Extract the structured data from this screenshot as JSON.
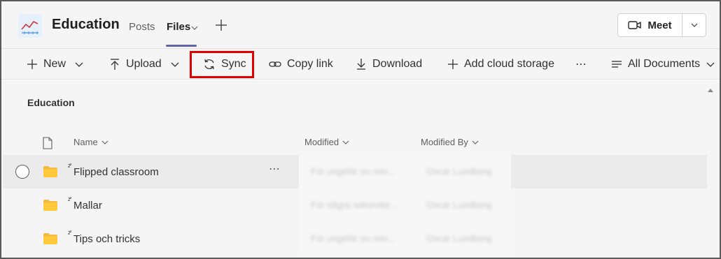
{
  "header": {
    "team_name": "Education",
    "tabs": [
      {
        "label": "Posts",
        "active": false
      },
      {
        "label": "Files",
        "active": true
      }
    ],
    "meet_label": "Meet",
    "accent_color": "#6264a7"
  },
  "toolbar": {
    "new_label": "New",
    "upload_label": "Upload",
    "sync_label": "Sync",
    "copy_link_label": "Copy link",
    "download_label": "Download",
    "add_cloud_storage_label": "Add cloud storage",
    "more_label": "⋯",
    "view_label": "All Documents",
    "highlight_color": "#e00000"
  },
  "library": {
    "title": "Education",
    "columns": {
      "name": "Name",
      "modified": "Modified",
      "modified_by": "Modified By"
    },
    "rows": [
      {
        "name": "Flipped classroom",
        "modified": "För ungefär en min...",
        "modified_by": "Oscar Lundberg",
        "hovered": true
      },
      {
        "name": "Mallar",
        "modified": "För några sekunder...",
        "modified_by": "Oscar Lundberg",
        "hovered": false
      },
      {
        "name": "Tips och tricks",
        "modified": "För ungefär en min...",
        "modified_by": "Oscar Lundberg",
        "hovered": false
      }
    ],
    "row_more_label": "⋯"
  },
  "icons": [
    "team-chart-icon",
    "chevron-down-icon",
    "plus-icon",
    "video-camera-icon",
    "upload-icon",
    "sync-icon",
    "link-icon",
    "download-icon",
    "list-view-icon",
    "document-icon",
    "folder-icon",
    "new-item-marker-icon",
    "scroll-up-icon"
  ]
}
